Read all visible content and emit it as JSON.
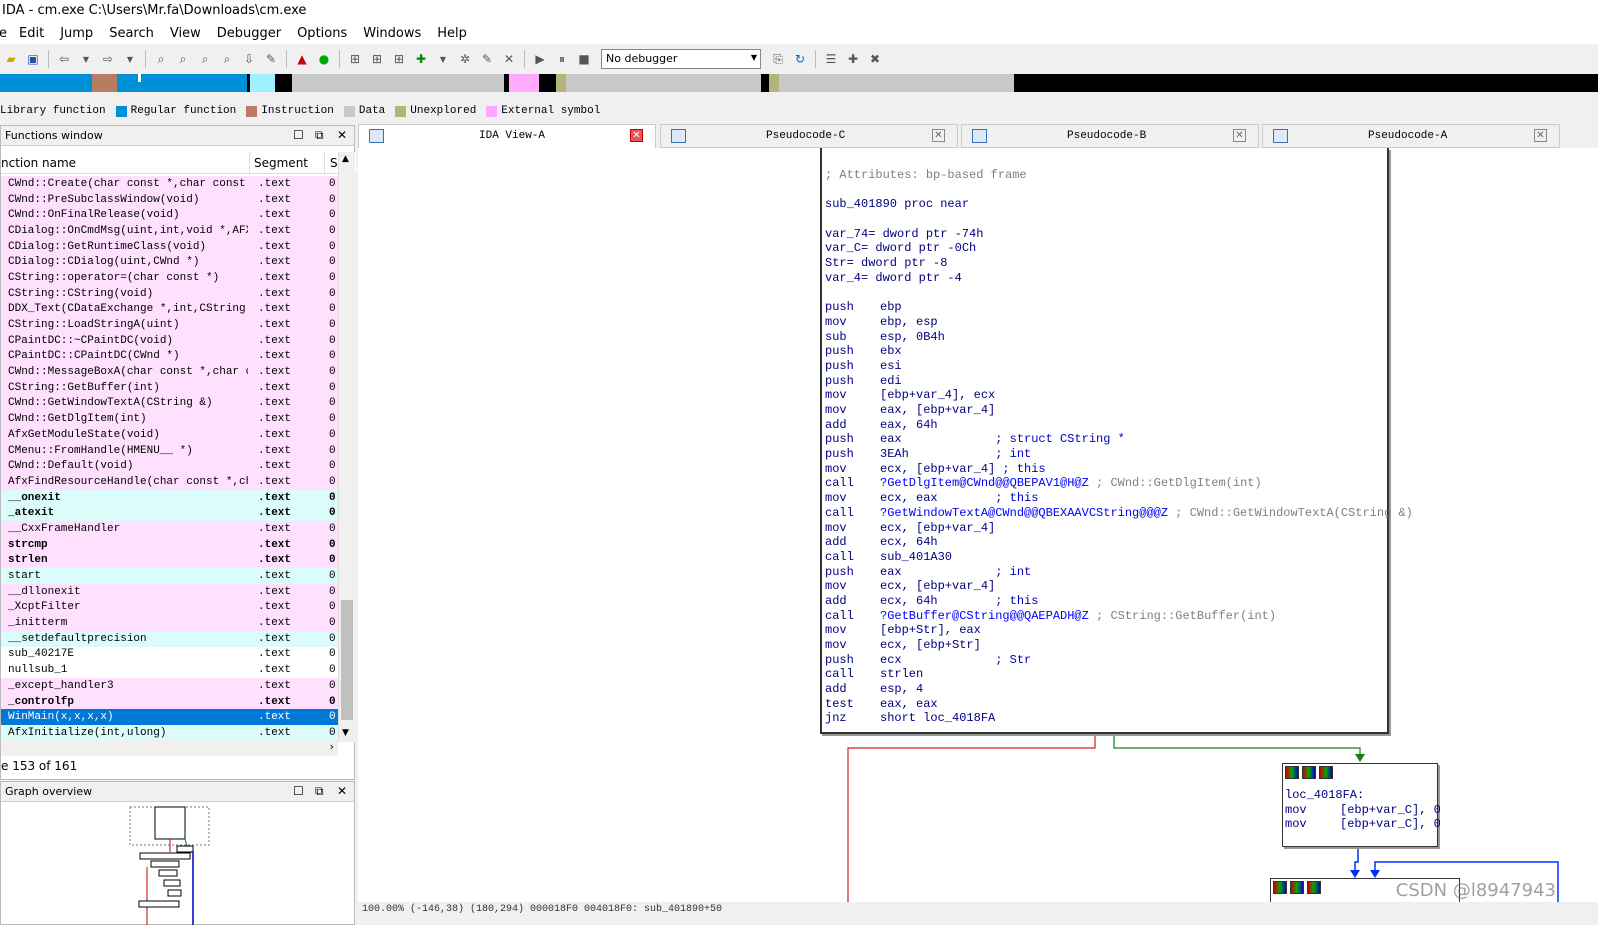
{
  "window": {
    "title": "IDA - cm.exe C:\\Users\\Mr.fa\\Downloads\\cm.exe"
  },
  "menu": [
    "e",
    "Edit",
    "Jump",
    "Search",
    "View",
    "Debugger",
    "Options",
    "Windows",
    "Help"
  ],
  "toolbar": {
    "debugger": "No debugger"
  },
  "legend": [
    {
      "label": "Library function",
      "color": "#00b4ff"
    },
    {
      "label": "Regular function",
      "color": "#0090d8"
    },
    {
      "label": "Instruction",
      "color": "#b77d62"
    },
    {
      "label": "Data",
      "color": "#c8c8c8"
    },
    {
      "label": "Unexplored",
      "color": "#b4b478"
    },
    {
      "label": "External symbol",
      "color": "#ffaaff"
    }
  ],
  "functions_window": {
    "title": "Functions window",
    "col_name": "nction name",
    "col_segment": "Segment",
    "col_s": "S",
    "status": "e 153 of 161",
    "rows": [
      {
        "name": "CWnd::Create(char const *,char const *···",
        "seg": ".text",
        "s": "0",
        "bg": "#ffe0ff",
        "bold": false
      },
      {
        "name": "CWnd::PreSubclassWindow(void)",
        "seg": ".text",
        "s": "0",
        "bg": "#ffe0ff",
        "bold": false
      },
      {
        "name": "CWnd::OnFinalRelease(void)",
        "seg": ".text",
        "s": "0",
        "bg": "#ffe0ff",
        "bold": false
      },
      {
        "name": "CDialog::OnCmdMsg(uint,int,void *,AFX_···",
        "seg": ".text",
        "s": "0",
        "bg": "#ffe0ff",
        "bold": false
      },
      {
        "name": "CDialog::GetRuntimeClass(void)",
        "seg": ".text",
        "s": "0",
        "bg": "#ffe0ff",
        "bold": false
      },
      {
        "name": "CDialog::CDialog(uint,CWnd *)",
        "seg": ".text",
        "s": "0",
        "bg": "#ffe0ff",
        "bold": false
      },
      {
        "name": "CString::operator=(char const *)",
        "seg": ".text",
        "s": "0",
        "bg": "#ffe0ff",
        "bold": false
      },
      {
        "name": "CString::CString(void)",
        "seg": ".text",
        "s": "0",
        "bg": "#ffe0ff",
        "bold": false
      },
      {
        "name": "DDX_Text(CDataExchange *,int,CString &)",
        "seg": ".text",
        "s": "0",
        "bg": "#ffe0ff",
        "bold": false
      },
      {
        "name": "CString::LoadStringA(uint)",
        "seg": ".text",
        "s": "0",
        "bg": "#ffe0ff",
        "bold": false
      },
      {
        "name": "CPaintDC::~CPaintDC(void)",
        "seg": ".text",
        "s": "0",
        "bg": "#ffe0ff",
        "bold": false
      },
      {
        "name": "CPaintDC::CPaintDC(CWnd *)",
        "seg": ".text",
        "s": "0",
        "bg": "#ffe0ff",
        "bold": false
      },
      {
        "name": "CWnd::MessageBoxA(char const *,char co···",
        "seg": ".text",
        "s": "0",
        "bg": "#ffe0ff",
        "bold": false
      },
      {
        "name": "CString::GetBuffer(int)",
        "seg": ".text",
        "s": "0",
        "bg": "#ffe0ff",
        "bold": false
      },
      {
        "name": "CWnd::GetWindowTextA(CString &)",
        "seg": ".text",
        "s": "0",
        "bg": "#ffe0ff",
        "bold": false
      },
      {
        "name": "CWnd::GetDlgItem(int)",
        "seg": ".text",
        "s": "0",
        "bg": "#ffe0ff",
        "bold": false
      },
      {
        "name": "AfxGetModuleState(void)",
        "seg": ".text",
        "s": "0",
        "bg": "#ffe0ff",
        "bold": false
      },
      {
        "name": "CMenu::FromHandle(HMENU__ *)",
        "seg": ".text",
        "s": "0",
        "bg": "#ffe0ff",
        "bold": false
      },
      {
        "name": "CWnd::Default(void)",
        "seg": ".text",
        "s": "0",
        "bg": "#ffe0ff",
        "bold": false
      },
      {
        "name": "AfxFindResourceHandle(char const *,cha···",
        "seg": ".text",
        "s": "0",
        "bg": "#ffe0ff",
        "bold": false
      },
      {
        "name": "__onexit",
        "seg": ".text",
        "s": "0",
        "bg": "#dcfcfc",
        "bold": true
      },
      {
        "name": "_atexit",
        "seg": ".text",
        "s": "0",
        "bg": "#dcfcfc",
        "bold": true
      },
      {
        "name": "__CxxFrameHandler",
        "seg": ".text",
        "s": "0",
        "bg": "#ffe0ff",
        "bold": false
      },
      {
        "name": "strcmp",
        "seg": ".text",
        "s": "0",
        "bg": "#ffe0ff",
        "bold": true
      },
      {
        "name": "strlen",
        "seg": ".text",
        "s": "0",
        "bg": "#ffe0ff",
        "bold": true
      },
      {
        "name": "start",
        "seg": ".text",
        "s": "0",
        "bg": "#dcfcfc",
        "bold": false
      },
      {
        "name": "__dllonexit",
        "seg": ".text",
        "s": "0",
        "bg": "#ffe0ff",
        "bold": false
      },
      {
        "name": "_XcptFilter",
        "seg": ".text",
        "s": "0",
        "bg": "#ffe0ff",
        "bold": false
      },
      {
        "name": "_initterm",
        "seg": ".text",
        "s": "0",
        "bg": "#ffe0ff",
        "bold": false
      },
      {
        "name": "__setdefaultprecision",
        "seg": ".text",
        "s": "0",
        "bg": "#dcfcfc",
        "bold": false
      },
      {
        "name": "sub_40217E",
        "seg": ".text",
        "s": "0",
        "bg": "#ffffff",
        "bold": false
      },
      {
        "name": "nullsub_1",
        "seg": ".text",
        "s": "0",
        "bg": "#ffffff",
        "bold": false
      },
      {
        "name": "_except_handler3",
        "seg": ".text",
        "s": "0",
        "bg": "#ffe0ff",
        "bold": false
      },
      {
        "name": "_controlfp",
        "seg": ".text",
        "s": "0",
        "bg": "#ffe0ff",
        "bold": true
      },
      {
        "name": "WinMain(x,x,x,x)",
        "seg": ".text",
        "s": "0",
        "bg": "#0078d7",
        "bold": false,
        "selected": true
      },
      {
        "name": "AfxInitialize(int,ulong)",
        "seg": ".text",
        "s": "0",
        "bg": "#dcfcfc",
        "bold": false
      }
    ]
  },
  "graph_overview": {
    "title": "Graph overview"
  },
  "tabs": [
    {
      "label": "IDA View-A",
      "active": true
    },
    {
      "label": "Pseudocode-C",
      "active": false
    },
    {
      "label": "Pseudocode-B",
      "active": false
    },
    {
      "label": "Pseudocode-A",
      "active": false
    }
  ],
  "disasm": {
    "lines": [
      {
        "t": "att",
        "text": "; Attributes: bp-based frame"
      },
      {
        "t": "blank"
      },
      {
        "t": "plain",
        "text": "sub_401890 proc near"
      },
      {
        "t": "blank"
      },
      {
        "t": "plain",
        "text": "var_74= dword ptr -74h"
      },
      {
        "t": "plain",
        "text": "var_C= dword ptr -0Ch"
      },
      {
        "t": "plain",
        "text": "Str= dword ptr -8"
      },
      {
        "t": "plain",
        "text": "var_4= dword ptr -4"
      },
      {
        "t": "blank"
      },
      {
        "t": "ins",
        "m": "push",
        "op": "ebp"
      },
      {
        "t": "ins",
        "m": "mov",
        "op": "ebp, esp"
      },
      {
        "t": "ins",
        "m": "sub",
        "op": "esp, 0B4h"
      },
      {
        "t": "ins",
        "m": "push",
        "op": "ebx"
      },
      {
        "t": "ins",
        "m": "push",
        "op": "esi"
      },
      {
        "t": "ins",
        "m": "push",
        "op": "edi"
      },
      {
        "t": "ins",
        "m": "mov",
        "op": "[ebp+var_4], ecx"
      },
      {
        "t": "ins",
        "m": "mov",
        "op": "eax, [ebp+var_4]"
      },
      {
        "t": "ins",
        "m": "add",
        "op": "eax, 64h"
      },
      {
        "t": "ins",
        "m": "push",
        "op": "eax             ",
        "cm": "; struct CString *"
      },
      {
        "t": "ins",
        "m": "push",
        "op": "3EAh            ",
        "cm": "; int"
      },
      {
        "t": "ins",
        "m": "mov",
        "op": "ecx, [ebp+var_4] ",
        "cm": "; this"
      },
      {
        "t": "ins",
        "m": "call",
        "lnk": "?GetDlgItem@CWnd@@QBEPAV1@H@Z",
        "g": " ; CWnd::GetDlgItem(int)"
      },
      {
        "t": "ins",
        "m": "mov",
        "op": "ecx, eax        ",
        "cm": "; this"
      },
      {
        "t": "ins",
        "m": "call",
        "lnk": "?GetWindowTextA@CWnd@@QBEXAAVCString@@@Z",
        "g": " ; CWnd::GetWindowTextA(CString &)"
      },
      {
        "t": "ins",
        "m": "mov",
        "op": "ecx, [ebp+var_4]"
      },
      {
        "t": "ins",
        "m": "add",
        "op": "ecx, 64h"
      },
      {
        "t": "ins",
        "m": "call",
        "op": "sub_401A30"
      },
      {
        "t": "ins",
        "m": "push",
        "op": "eax             ",
        "cm": "; int"
      },
      {
        "t": "ins",
        "m": "mov",
        "op": "ecx, [ebp+var_4]"
      },
      {
        "t": "ins",
        "m": "add",
        "op": "ecx, 64h        ",
        "cm": "; this"
      },
      {
        "t": "ins",
        "m": "call",
        "lnk": "?GetBuffer@CString@@QAEPADH@Z",
        "g": " ; CString::GetBuffer(int)"
      },
      {
        "t": "ins",
        "m": "mov",
        "op": "[ebp+Str], eax"
      },
      {
        "t": "ins",
        "m": "mov",
        "op": "ecx, [ebp+Str]"
      },
      {
        "t": "ins",
        "m": "push",
        "op": "ecx             ",
        "cm": "; Str"
      },
      {
        "t": "ins",
        "m": "call",
        "op": "strlen"
      },
      {
        "t": "ins",
        "m": "add",
        "op": "esp, 4"
      },
      {
        "t": "ins",
        "m": "test",
        "op": "eax, eax"
      },
      {
        "t": "ins",
        "m": "jnz",
        "op": "short loc_4018FA"
      }
    ]
  },
  "block2": {
    "lines": [
      {
        "t": "plain",
        "text": "loc_4018FA:"
      },
      {
        "t": "ins",
        "m": "mov",
        "op": "[ebp+var_C], 0"
      },
      {
        "t": "ins",
        "m": "mov",
        "op": "[ebp+var_C], 0"
      }
    ]
  },
  "status": {
    "text": "100.00% (-146,38) (180,294) 000018F0 004018F0: sub_401890+50"
  },
  "watermark": "CSDN @l8947943"
}
